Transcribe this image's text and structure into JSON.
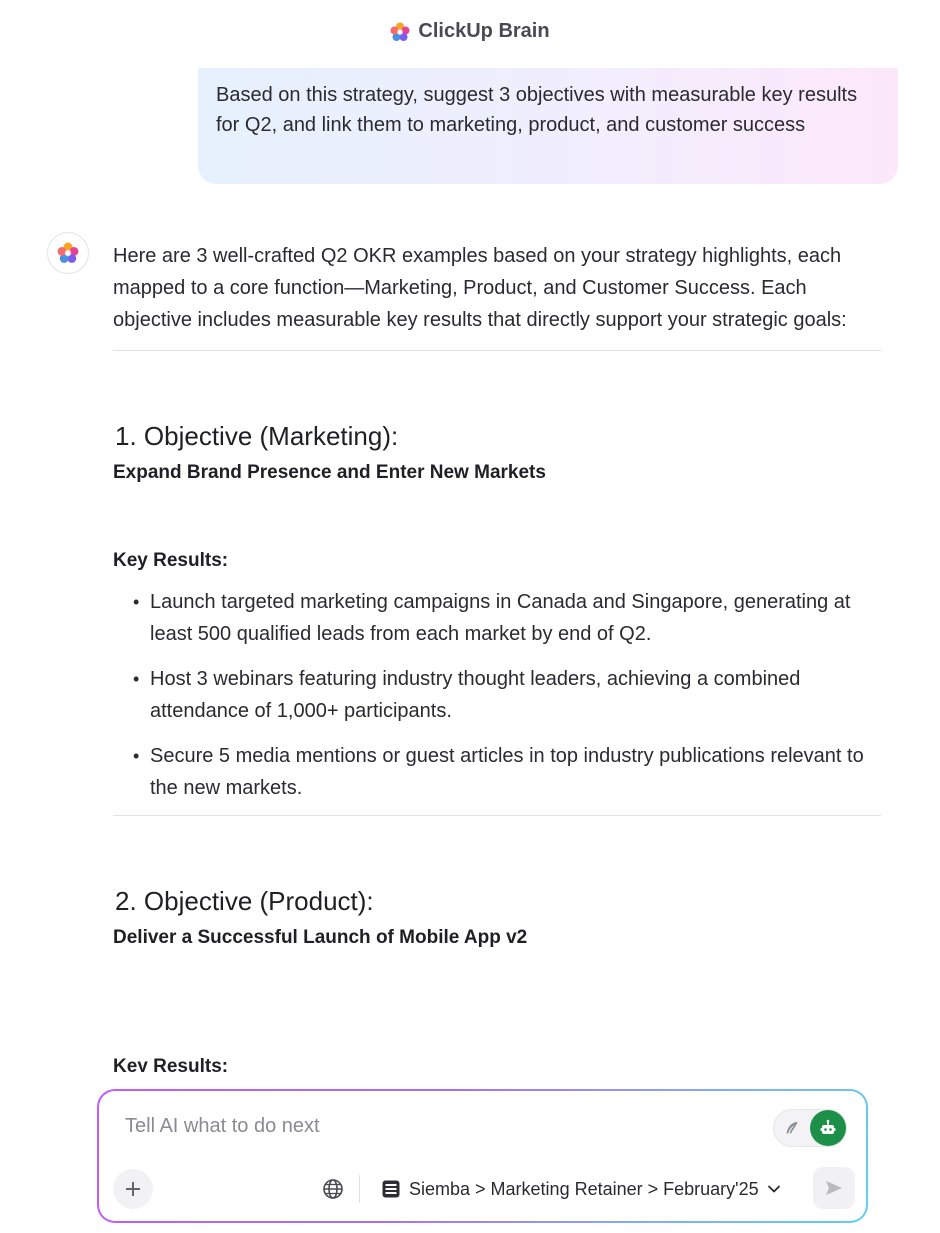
{
  "header": {
    "title": "ClickUp Brain"
  },
  "user_message": "Based on this strategy, suggest 3 objectives with measurable key results for Q2, and link them to marketing, product, and customer success",
  "response": {
    "intro": "Here are 3 well-crafted Q2 OKR examples based on your strategy highlights, each mapped to a core function—Marketing, Product, and Customer Success. Each objective includes measurable key results that directly support your strategic goals:",
    "objectives": [
      {
        "heading": "1. Objective (Marketing):",
        "subtitle": "Expand Brand Presence and Enter New Markets",
        "kr_label": "Key Results:",
        "key_results": [
          "Launch targeted marketing campaigns in Canada and Singapore, generating at least 500 qualified leads from each market by end of Q2.",
          "Host 3 webinars featuring industry thought leaders, achieving a combined attendance of 1,000+ participants.",
          "Secure 5 media mentions or guest articles in top industry publications relevant to the new markets."
        ]
      },
      {
        "heading": "2. Objective (Product):",
        "subtitle": "Deliver a Successful Launch of Mobile App v2",
        "kr_label": "Key Results:"
      }
    ]
  },
  "composer": {
    "placeholder": "Tell AI what to do next",
    "location": "Siemba > Marketing Retainer > February'25",
    "icons": {
      "plus": "plus-icon",
      "globe": "globe-icon",
      "location": "list-icon",
      "dropdown": "chevron-down-icon",
      "send": "send-icon",
      "toggle_left": "feather-icon",
      "toggle_right": "robot-icon"
    }
  },
  "colors": {
    "accent_green": "#1d8f48",
    "gradient_start": "#c75cf0",
    "gradient_end": "#5fd0ee"
  }
}
